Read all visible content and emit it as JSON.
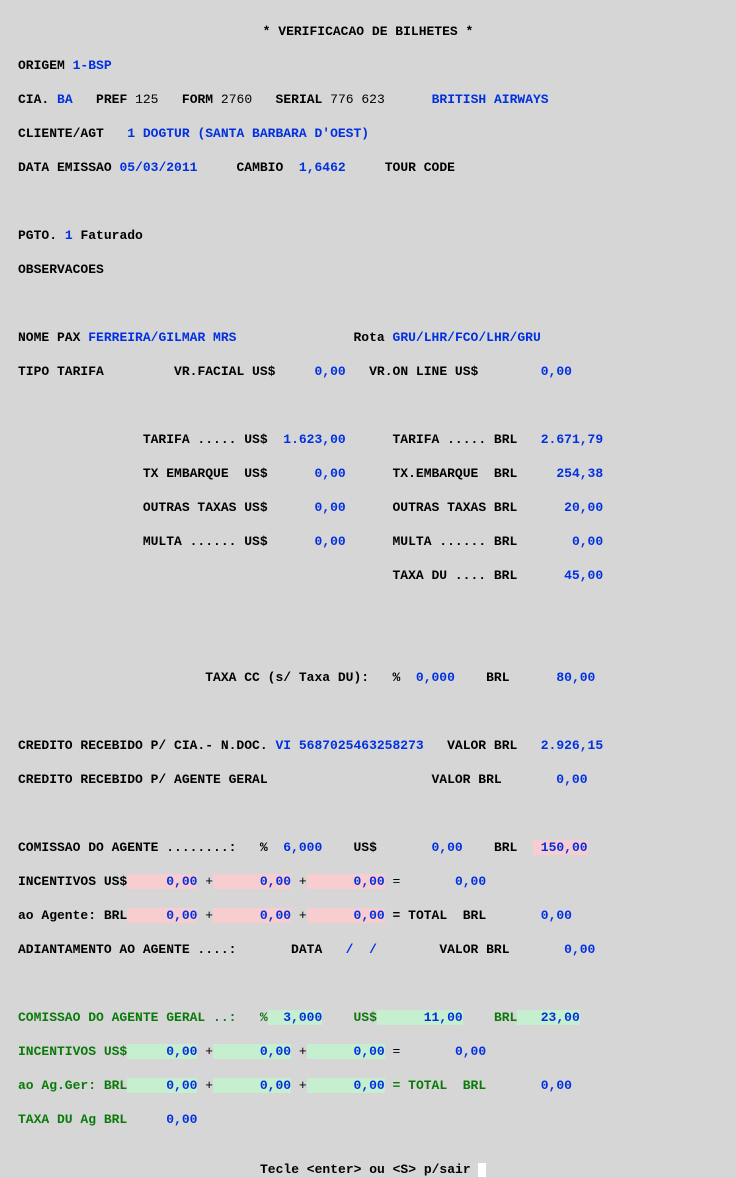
{
  "title": "* VERIFICACAO DE BILHETES *",
  "origem": {
    "label": "ORIGEM",
    "value": "1-BSP"
  },
  "cia": {
    "label": "CIA.",
    "code": "BA",
    "pref_label": "PREF",
    "pref": "125",
    "form_label": "FORM",
    "form": "2760",
    "serial_label": "SERIAL",
    "serial": "776 623",
    "airline": "BRITISH AIRWAYS"
  },
  "cliente": {
    "label": "CLIENTE/AGT",
    "value": "1 DOGTUR (SANTA BARBARA D'OEST)"
  },
  "emissao": {
    "label": "DATA EMISSAO",
    "value": "05/03/2011",
    "cambio_label": "CAMBIO",
    "cambio": "1,6462",
    "tour_label": "TOUR CODE"
  },
  "pgto": {
    "label": "PGTO.",
    "code": "1",
    "desc": "Faturado"
  },
  "obs": {
    "label": "OBSERVACOES"
  },
  "pax": {
    "label": "NOME PAX",
    "value": "FERREIRA/GILMAR MRS",
    "rota_label": "Rota",
    "rota": "GRU/LHR/FCO/LHR/GRU"
  },
  "tarifa_line": {
    "label": "TIPO TARIFA",
    "facial_label": "VR.FACIAL US$",
    "facial": "0,00",
    "online_label": "VR.ON LINE US$",
    "online": "0,00"
  },
  "usd": {
    "tarifa_label": "TARIFA ..... US$",
    "tarifa": "1.623,00",
    "tx_label": "TX EMBARQUE  US$",
    "tx": "0,00",
    "outras_label": "OUTRAS TAXAS US$",
    "outras": "0,00",
    "multa_label": "MULTA ...... US$",
    "multa": "0,00"
  },
  "brl": {
    "tarifa_label": "TARIFA ..... BRL",
    "tarifa": "2.671,79",
    "tx_label": "TX.EMBARQUE  BRL",
    "tx": "254,38",
    "outras_label": "OUTRAS TAXAS BRL",
    "outras": "20,00",
    "multa_label": "MULTA ...... BRL",
    "multa": "0,00",
    "du_label": "TAXA DU .... BRL",
    "du": "45,00"
  },
  "taxa_cc": {
    "label": "TAXA CC (s/ Taxa DU):   %",
    "pct": "0,000",
    "cur": "BRL",
    "val": "80,00"
  },
  "credito_cia": {
    "label": "CREDITO RECEBIDO P/ CIA.- N.DOC.",
    "doc": "VI 5687025463258273",
    "valor_label": "VALOR BRL",
    "valor": "2.926,15"
  },
  "credito_geral": {
    "label": "CREDITO RECEBIDO P/ AGENTE GERAL",
    "valor_label": "VALOR BRL",
    "valor": "0,00"
  },
  "com_agente": {
    "label": "COMISSAO DO AGENTE ........:   %",
    "pct": "6,000",
    "usd_label": "US$",
    "usd": "0,00",
    "brl_label": "BRL",
    "brl": "150,00",
    "inc_label": "INCENTIVOS US$",
    "inc1": "0,00",
    "inc2": "0,00",
    "inc3": "0,00",
    "inc_eq": "0,00",
    "ao_label": "ao Agente: BRL",
    "ao1": "0,00",
    "ao2": "0,00",
    "ao3": "0,00",
    "ao_total_label": "= TOTAL  BRL",
    "ao_total": "0,00",
    "adi_label": "ADIANTAMENTO AO AGENTE ....:",
    "adi_data_label": "DATA",
    "adi_data": "/  /",
    "adi_val_label": "VALOR BRL",
    "adi_val": "0,00"
  },
  "com_geral": {
    "label": "COMISSAO DO AGENTE GERAL ..:   %",
    "pct": "3,000",
    "usd_label": "US$",
    "usd": "11,00",
    "brl_label": "BRL",
    "brl": "23,00",
    "inc_label": "INCENTIVOS US$",
    "inc1": "0,00",
    "inc2": "0,00",
    "inc3": "0,00",
    "inc_eq": "0,00",
    "ao_label": "ao Ag.Ger: BRL",
    "ao1": "0,00",
    "ao2": "0,00",
    "ao3": "0,00",
    "ao_total_label": "= TOTAL  BRL",
    "ao_total": "0,00",
    "du_label": "TAXA DU Ag BRL",
    "du": "0,00"
  },
  "footer": {
    "line": "Tecle <enter>  ou  <S> p/sair"
  }
}
